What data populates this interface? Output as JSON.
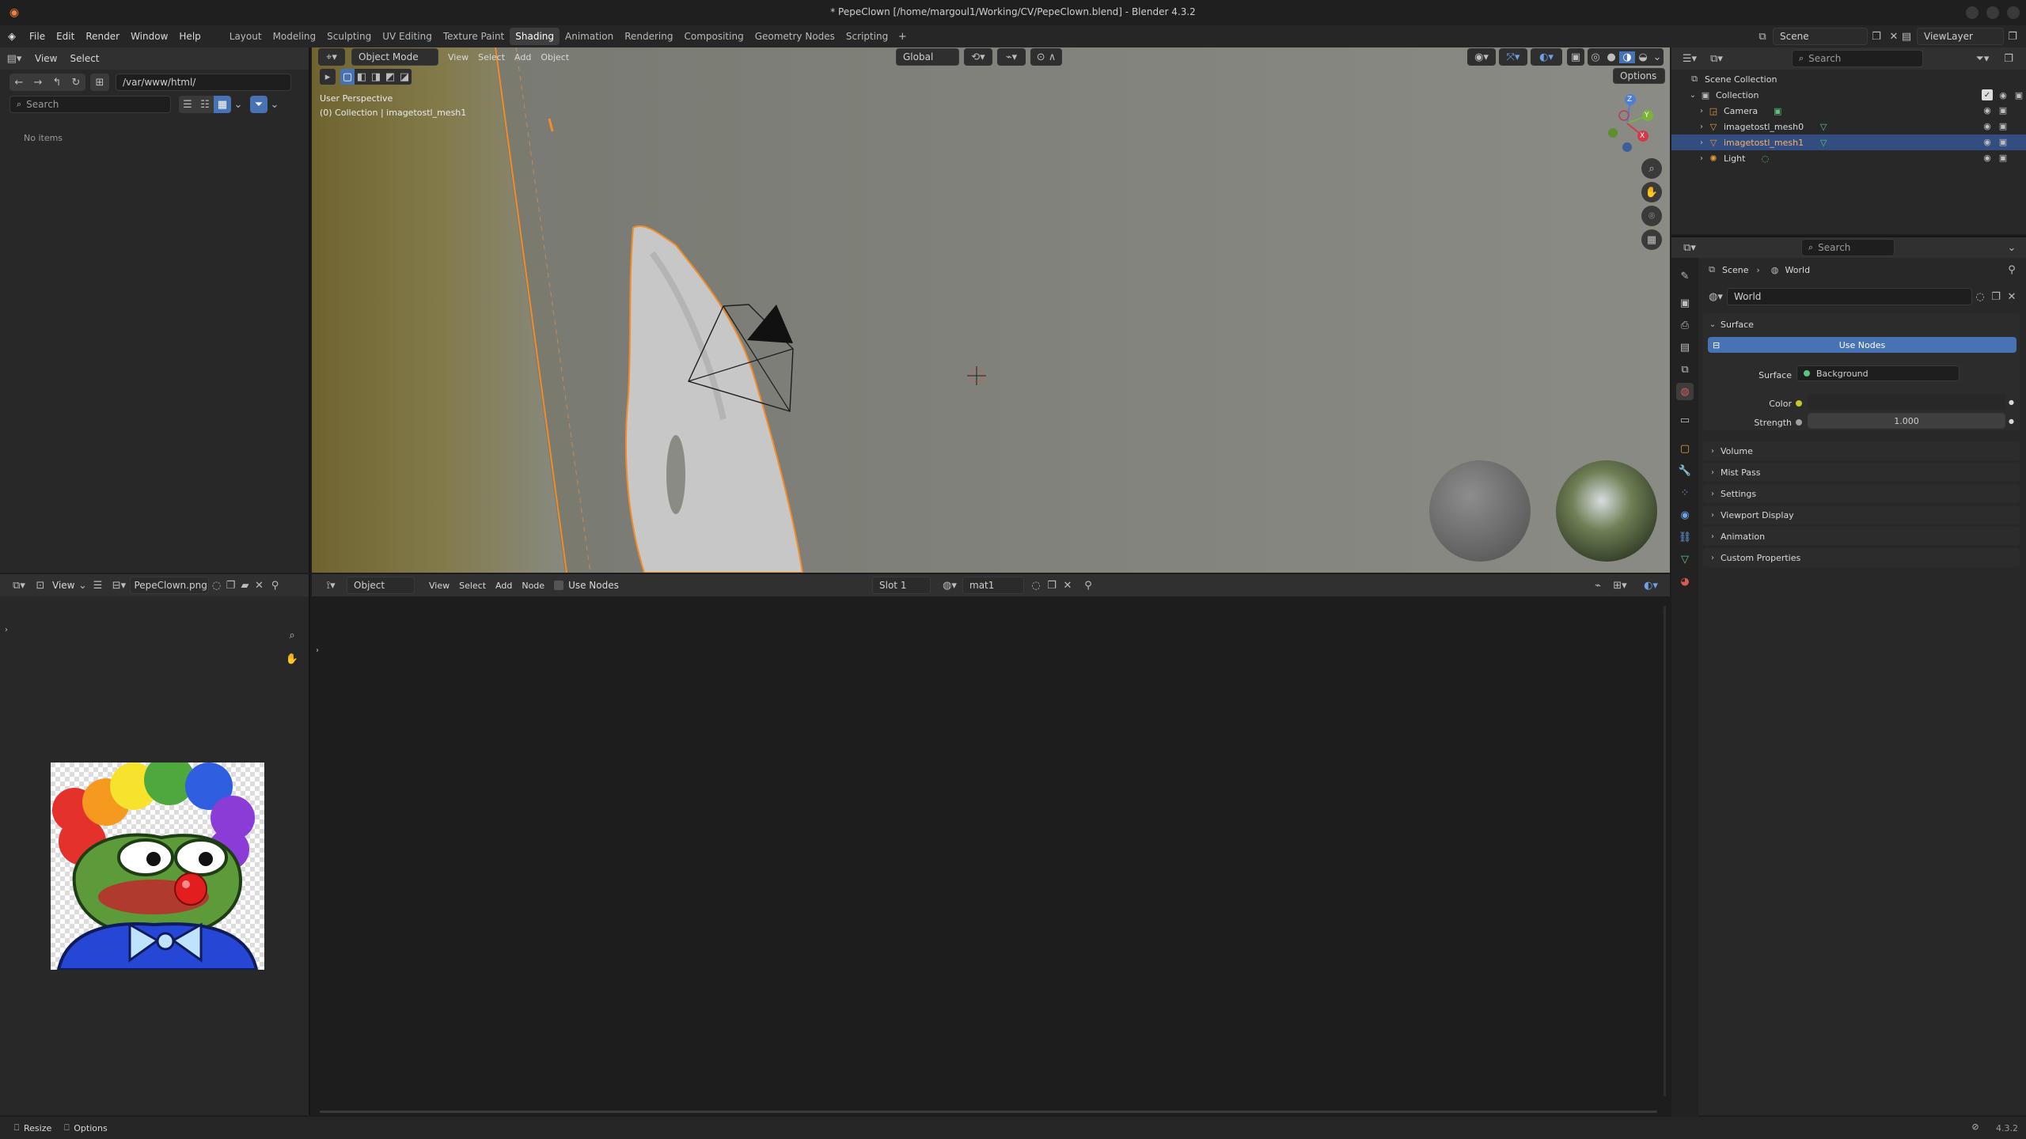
{
  "window": {
    "title": "* PepeClown [/home/margoul1/Working/CV/PepeClown.blend] - Blender 4.3.2"
  },
  "menu": [
    "File",
    "Edit",
    "Render",
    "Window",
    "Help"
  ],
  "workspaces": [
    "Layout",
    "Modeling",
    "Sculpting",
    "UV Editing",
    "Texture Paint",
    "Shading",
    "Animation",
    "Rendering",
    "Compositing",
    "Geometry Nodes",
    "Scripting"
  ],
  "active_workspace": "Shading",
  "topbar": {
    "scene": "Scene",
    "viewlayer": "ViewLayer"
  },
  "filebrowser": {
    "view": "View",
    "select": "Select",
    "path": "/var/www/html/",
    "search_placeholder": "Search",
    "empty": "No items"
  },
  "viewport": {
    "mode": "Object Mode",
    "menus": [
      "View",
      "Select",
      "Add",
      "Object"
    ],
    "transform": "Global",
    "options": "Options",
    "overlay_line1": "User Perspective",
    "overlay_line2": "(0) Collection | imagetostl_mesh1",
    "axes": [
      "X",
      "Y",
      "Z"
    ]
  },
  "image_editor": {
    "view": "View",
    "image_name": "PepeClown.png"
  },
  "node_editor": {
    "object": "Object",
    "menus": [
      "View",
      "Select",
      "Add",
      "Node"
    ],
    "use_nodes": "Use Nodes",
    "slot": "Slot 1",
    "material": "mat1"
  },
  "outliner": {
    "search_placeholder": "Search",
    "root": "Scene Collection",
    "collection": "Collection",
    "items": [
      {
        "name": "Camera",
        "selected": false
      },
      {
        "name": "imagetostl_mesh0",
        "selected": false
      },
      {
        "name": "imagetostl_mesh1",
        "selected": true
      },
      {
        "name": "Light",
        "selected": false
      }
    ]
  },
  "properties": {
    "search_placeholder": "Search",
    "breadcrumb": [
      "Scene",
      "World"
    ],
    "world_name": "World",
    "surface_panel": "Surface",
    "use_nodes": "Use Nodes",
    "surface_label": "Surface",
    "surface_value": "Background",
    "color_label": "Color",
    "strength_label": "Strength",
    "strength_value": "1.000",
    "panels": [
      "Volume",
      "Mist Pass",
      "Settings",
      "Viewport Display",
      "Animation",
      "Custom Properties"
    ]
  },
  "statusbar": {
    "resize": "Resize",
    "options": "Options",
    "version": "4.3.2"
  },
  "colors": {
    "accent": "#4772b3",
    "selected_outline": "#f28c28",
    "bg": "#1d1d1d"
  }
}
